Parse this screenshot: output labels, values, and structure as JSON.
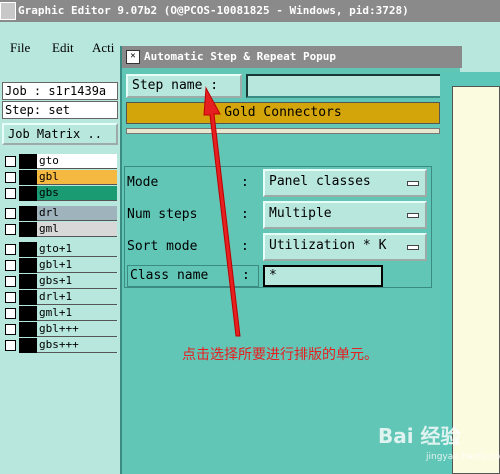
{
  "window": {
    "title": "Graphic Editor 9.07b2 (O@PCOS-10081825 - Windows, pid:3728)"
  },
  "menu": [
    "File",
    "Edit",
    "Acti"
  ],
  "job": {
    "label": "Job : s1r1439a",
    "step": "Step: set",
    "matrix_button": "Job Matrix .."
  },
  "layers_group1": [
    {
      "name": "gto",
      "color": "#ffffff"
    },
    {
      "name": "gbl",
      "color": "#f5b840"
    },
    {
      "name": "gbs",
      "color": "#1a9b72"
    }
  ],
  "layers_group2": [
    {
      "name": "drl",
      "color": "#9fb3bc"
    },
    {
      "name": "gml",
      "color": "#d8d8d8"
    }
  ],
  "layers_group3": [
    {
      "name": "gto+1",
      "color": "#b8e7de"
    },
    {
      "name": "gbl+1",
      "color": "#b8e7de"
    },
    {
      "name": "gbs+1",
      "color": "#b8e7de"
    },
    {
      "name": "drl+1",
      "color": "#b8e7de"
    },
    {
      "name": "gml+1",
      "color": "#b8e7de"
    },
    {
      "name": "gbl+++",
      "color": "#b8e7de"
    },
    {
      "name": "gbs+++",
      "color": "#b8e7de"
    }
  ],
  "popup": {
    "title": "Automatic Step & Repeat Popup",
    "step_name_button": "Step name :",
    "step_name_value": "",
    "banner": "Gold Connectors",
    "rows": [
      {
        "label": "Mode",
        "value": "Panel classes"
      },
      {
        "label": "Num steps",
        "value": "Multiple"
      },
      {
        "label": "Sort mode",
        "value": "Utilization * K"
      }
    ],
    "class_name_label": "Class name",
    "class_name_value": "*"
  },
  "annotation": "点击选择所要进行排版的单元。",
  "watermark": "Bai 经验",
  "watermark_sub": "jingyan.baidu.com",
  "colors": {
    "banner": "#d4a50a",
    "titlebar": "#8a8a8a",
    "panel": "#b8e7de",
    "arrow": "#e62020"
  }
}
